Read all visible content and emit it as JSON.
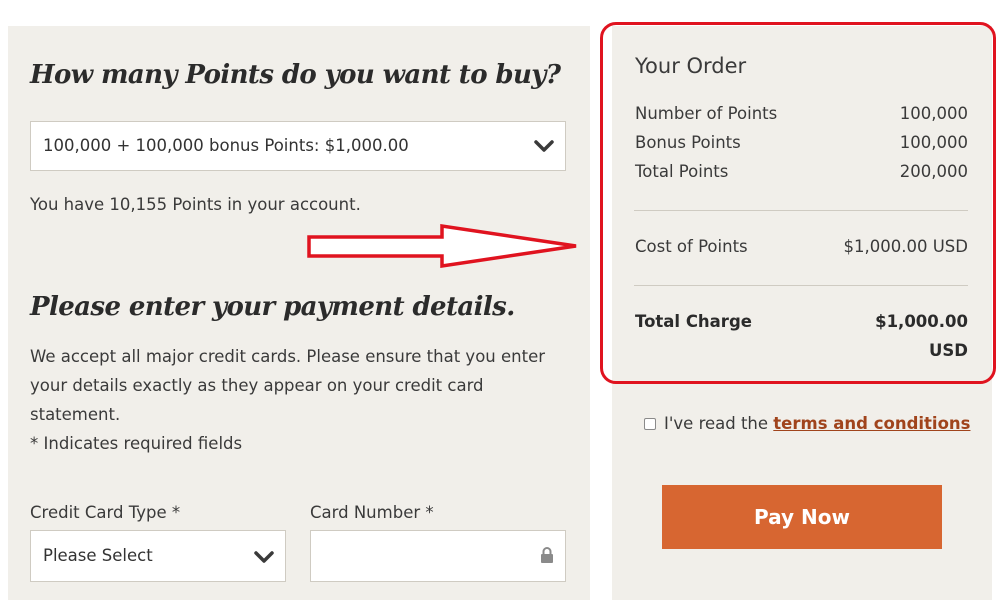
{
  "buy_section": {
    "heading": "How many Points do you want to buy?",
    "points_select_value": "100,000 + 100,000 bonus Points: $1,000.00",
    "balance_text": "You have 10,155 Points in your account."
  },
  "payment_section": {
    "heading": "Please enter your payment details.",
    "desc_line1": "We accept all major credit cards. Please ensure that you enter",
    "desc_line2": "your details exactly as they appear on your credit card",
    "desc_line3": "statement.",
    "required_note": "* Indicates required fields",
    "card_type_label": "Credit Card Type *",
    "card_type_value": "Please Select",
    "card_number_label": "Card Number *",
    "card_number_value": ""
  },
  "order": {
    "title": "Your Order",
    "rows": [
      {
        "label": "Number of Points",
        "value": "100,000"
      },
      {
        "label": "Bonus Points",
        "value": "100,000"
      },
      {
        "label": "Total Points",
        "value": "200,000"
      }
    ],
    "cost_label": "Cost of Points",
    "cost_value": "$1,000.00 USD",
    "total_label": "Total Charge",
    "total_amount": "$1,000.00",
    "total_currency": "USD"
  },
  "terms": {
    "prefix": "I've read the ",
    "link_text": "terms and conditions"
  },
  "pay_button_label": "Pay Now",
  "icons": {
    "dropdown": "chevron-down-icon",
    "lock": "lock-icon",
    "annotation_arrow": "right-arrow-annotation"
  },
  "colors": {
    "panel_bg": "#f1efea",
    "accent_button": "#d76631",
    "link": "#a0441c",
    "annotation_red": "#e0131f"
  }
}
